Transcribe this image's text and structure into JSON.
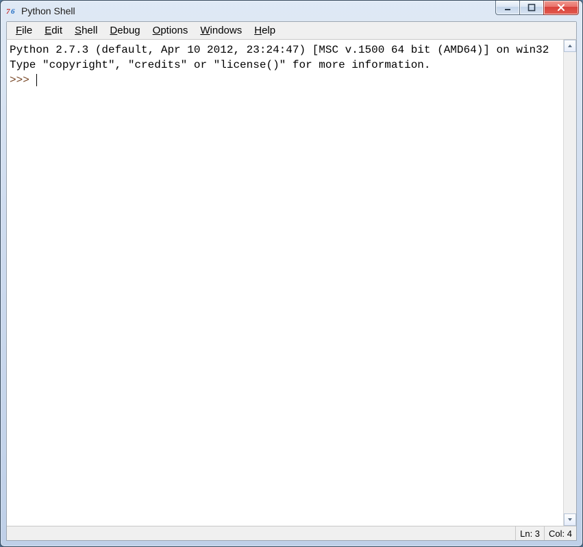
{
  "window": {
    "title": "Python Shell"
  },
  "menubar": {
    "items": [
      {
        "label": "File",
        "accel_index": 0
      },
      {
        "label": "Edit",
        "accel_index": 0
      },
      {
        "label": "Shell",
        "accel_index": 0
      },
      {
        "label": "Debug",
        "accel_index": 0
      },
      {
        "label": "Options",
        "accel_index": 0
      },
      {
        "label": "Windows",
        "accel_index": 0
      },
      {
        "label": "Help",
        "accel_index": 0
      }
    ]
  },
  "shell": {
    "banner_line1": "Python 2.7.3 (default, Apr 10 2012, 23:24:47) [MSC v.1500 64 bit (AMD64)] on win32",
    "banner_line2": "Type \"copyright\", \"credits\" or \"license()\" for more information.",
    "prompt": ">>> "
  },
  "status": {
    "line_label": "Ln: 3",
    "col_label": "Col: 4"
  }
}
